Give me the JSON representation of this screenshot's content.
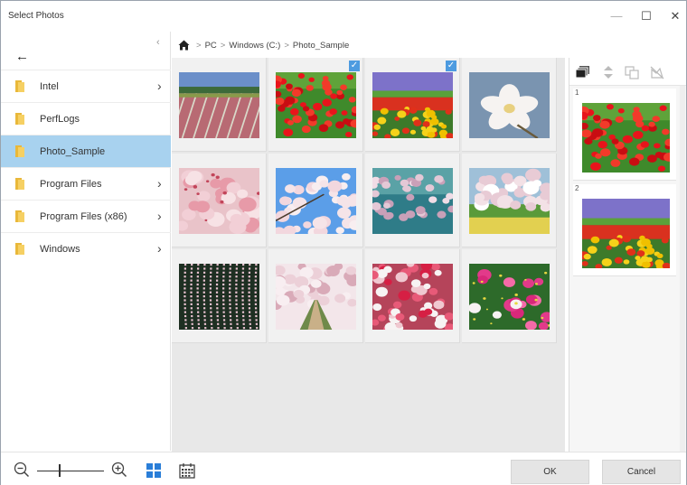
{
  "window": {
    "title": "Select Photos",
    "controls": [
      "—",
      "☐",
      "✕"
    ]
  },
  "sidebar": {
    "collapse_glyph": "‹",
    "back_glyph": "←",
    "items": [
      {
        "label": "Intel",
        "has_children": true,
        "selected": false
      },
      {
        "label": "PerfLogs",
        "has_children": false,
        "selected": false
      },
      {
        "label": "Photo_Sample",
        "has_children": false,
        "selected": true
      },
      {
        "label": "Program Files",
        "has_children": true,
        "selected": false
      },
      {
        "label": "Program Files (x86)",
        "has_children": true,
        "selected": false
      },
      {
        "label": "Windows",
        "has_children": true,
        "selected": false
      }
    ]
  },
  "breadcrumb": {
    "items": [
      "PC",
      "Windows (C:)",
      "Photo_Sample"
    ],
    "separator": ">"
  },
  "photos": [
    {
      "scene": "tulip-field",
      "checked": false
    },
    {
      "scene": "red-tulips",
      "checked": true
    },
    {
      "scene": "flower-stripes",
      "checked": true
    },
    {
      "scene": "white-blossom",
      "checked": false
    },
    {
      "scene": "pink-cherry",
      "checked": false
    },
    {
      "scene": "cherry-sky",
      "checked": false
    },
    {
      "scene": "cherry-teal",
      "checked": false
    },
    {
      "scene": "cherry-tree",
      "checked": false
    },
    {
      "scene": "weeping-cherry",
      "checked": false
    },
    {
      "scene": "cherry-path",
      "checked": false
    },
    {
      "scene": "peach-blossom",
      "checked": false
    },
    {
      "scene": "cosmos",
      "checked": false
    }
  ],
  "selected_panel": {
    "items": [
      {
        "number": "1",
        "scene": "red-tulips"
      },
      {
        "number": "2",
        "scene": "flower-stripes"
      }
    ]
  },
  "footer": {
    "ok_label": "OK",
    "cancel_label": "Cancel",
    "check_glyph": "✓"
  },
  "colors": {
    "selection": "#a8d2ef",
    "accent": "#2a7ed8",
    "check": "#4d9be0"
  }
}
